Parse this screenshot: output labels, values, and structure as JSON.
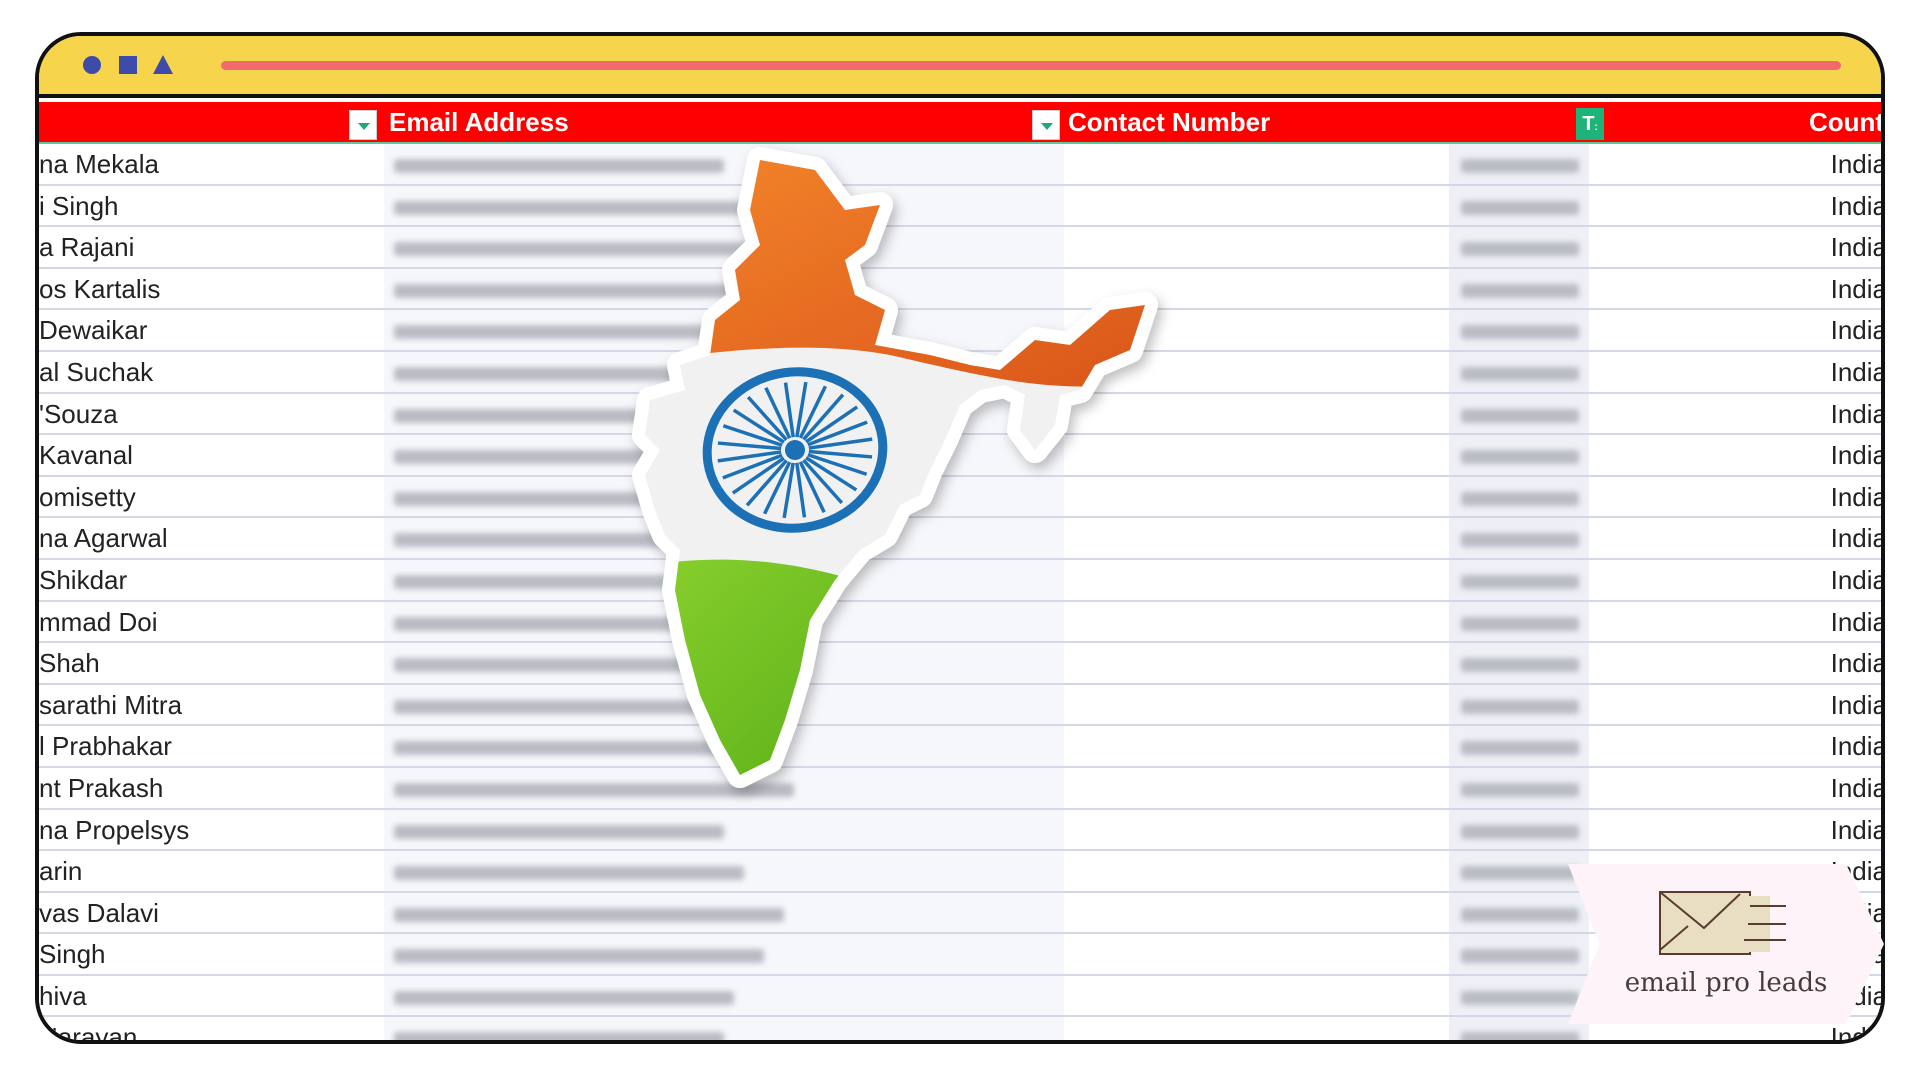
{
  "window": {
    "controls": [
      "circle-control",
      "square-control",
      "triangle-control"
    ]
  },
  "sheet": {
    "headers": {
      "name": "",
      "email": "Email Address",
      "contact": "Contact Number",
      "country": "Count"
    },
    "rows": [
      {
        "name": "na Mekala",
        "country": "India"
      },
      {
        "name": "i Singh",
        "country": "India"
      },
      {
        "name": "a Rajani",
        "country": "India"
      },
      {
        "name": "os Kartalis",
        "country": "India"
      },
      {
        "name": " Dewaikar",
        "country": "India"
      },
      {
        "name": "al Suchak",
        "country": "India"
      },
      {
        "name": "'Souza",
        "country": "India"
      },
      {
        "name": " Kavanal",
        "country": "India"
      },
      {
        "name": "omisetty",
        "country": "India"
      },
      {
        "name": "na Agarwal",
        "country": "India"
      },
      {
        "name": " Shikdar",
        "country": "India"
      },
      {
        "name": "mmad Doi",
        "country": "India"
      },
      {
        "name": "Shah",
        "country": "India"
      },
      {
        "name": "sarathi Mitra",
        "country": "India"
      },
      {
        "name": "l Prabhakar",
        "country": "India"
      },
      {
        "name": "nt Prakash",
        "country": "India"
      },
      {
        "name": "na Propelsys",
        "country": "India"
      },
      {
        "name": "arin",
        "country": "India"
      },
      {
        "name": "vas Dalavi",
        "country": "India"
      },
      {
        "name": "Singh",
        "country": "India"
      },
      {
        "name": "hiva",
        "country": "India"
      },
      {
        "name": "Narayan",
        "country": "India"
      }
    ]
  },
  "overlay": {
    "map": "india-flag-map",
    "colors": {
      "saffron": "#f47a20",
      "white": "#f1f1f1",
      "green": "#6cc01e",
      "chakra": "#1a6fb5"
    }
  },
  "brand": {
    "logo_text": "email pro leads"
  },
  "colors": {
    "titlebar": "#f6d54d",
    "titlebar_line": "#ef6b6e",
    "controls": "#3f4ba8",
    "header_bg": "#ff0000",
    "filter_active": "#1fb37a"
  }
}
